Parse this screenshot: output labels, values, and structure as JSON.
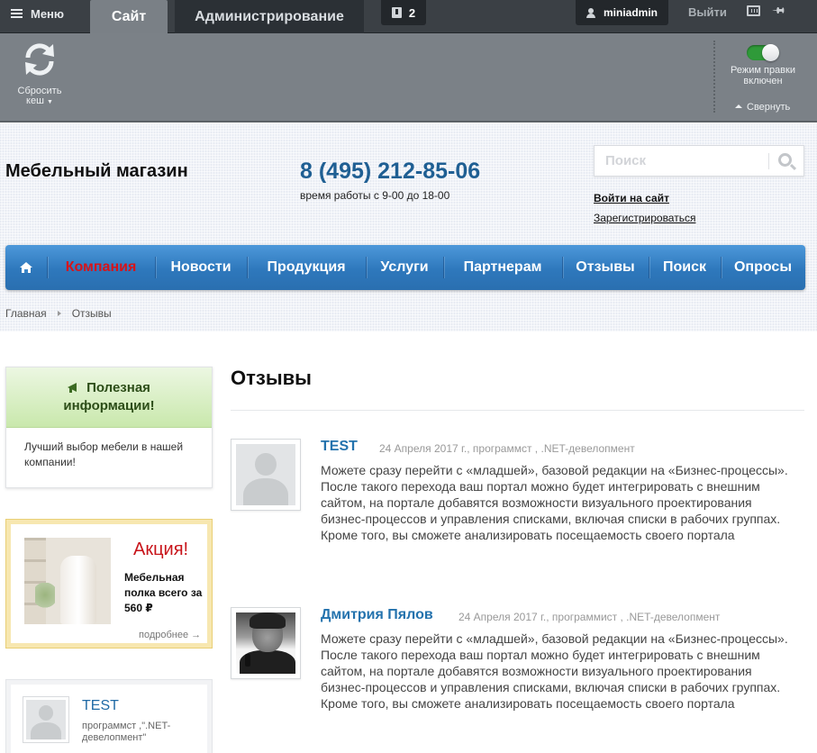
{
  "admin_bar": {
    "menu_label": "Меню",
    "tab_site": "Сайт",
    "tab_admin": "Администрирование",
    "notifications_count": "2",
    "username": "miniadmin",
    "logout_label": "Выйти"
  },
  "admin_toolbar": {
    "reset_cache_line1": "Сбросить",
    "reset_cache_line2": "кеш",
    "edit_mode_line1": "Режим правки",
    "edit_mode_line2": "включен",
    "collapse_label": "Свернуть"
  },
  "header": {
    "shop_name": "Мебельный магазин",
    "phone": "8 (495) 212-85-06",
    "hours": "время работы с 9-00 до 18-00",
    "search_placeholder": "Поиск",
    "login_label": "Войти на сайт",
    "register_label": "Зарегистрироваться"
  },
  "nav": {
    "items": [
      "Компания",
      "Новости",
      "Продукция",
      "Услуги",
      "Партнерам",
      "Отзывы",
      "Поиск",
      "Опросы"
    ],
    "active": "Компания"
  },
  "breadcrumb": [
    "Главная",
    "Отзывы"
  ],
  "sidebar": {
    "useful_title_line1": "Полезная",
    "useful_title_line2": "информации!",
    "useful_text": "Лучший выбор мебели в нашей компании!",
    "promo_title": "Акция!",
    "promo_desc": "Мебельная полка всего за 560 ₽",
    "promo_more": "подробнее →",
    "review_name": "TEST",
    "review_meta": "программст ,\".NET-девелопмент\"",
    "review_quote": "“..."
  },
  "main": {
    "title": "Отзывы",
    "reviews": [
      {
        "name": "TEST",
        "meta": "24 Апреля 2017 г., программст , .NET-девелопмент",
        "text": "Можете сразу перейти с «младшей», базовой редакции на «Бизнес-процессы». После такого перехода ваш портал можно будет интегрировать с внешним сайтом, на портале добавятся возможности визуального проектирования бизнес-процессов и управления списками, включая списки в рабочих группах. Кроме того, вы сможете анализировать посещаемость своего портала"
      },
      {
        "name": "Дмитрия Пялов",
        "meta": "24 Апреля 2017 г., программист , .NET-девелопмент",
        "text": "Можете сразу перейти с «младшей», базовой редакции на «Бизнес-процессы». После такого перехода ваш портал можно будет интегрировать с внешним сайтом, на портале добавятся возможности визуального проектирования бизнес-процессов и управления списками, включая списки в рабочих группах. Кроме того, вы сможете анализировать посещаемость своего портала"
      }
    ]
  },
  "colors": {
    "accent_blue": "#2e78bc",
    "active_red": "#d7141a",
    "admin_dark": "#3b4045"
  }
}
